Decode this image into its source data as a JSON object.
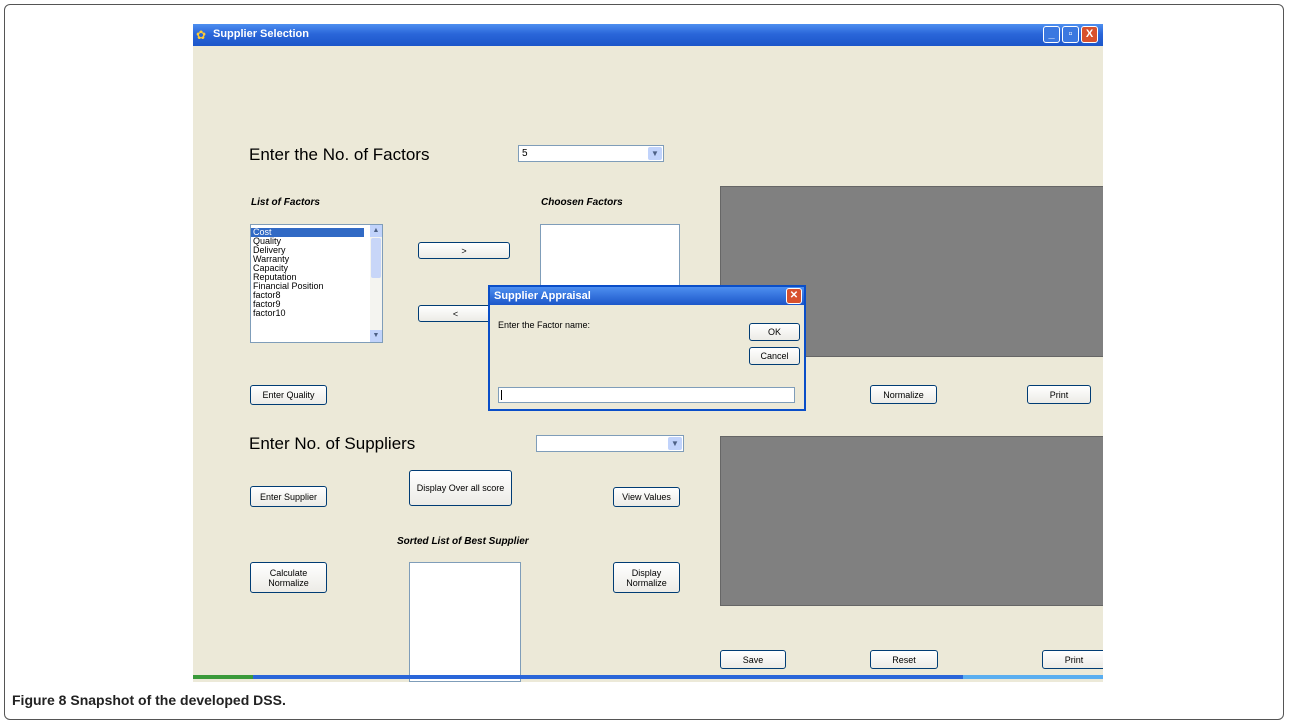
{
  "window": {
    "title": "Supplier Selection",
    "controls": [
      "_",
      "▫",
      "X"
    ]
  },
  "factors": {
    "label": "Enter the No. of Factors",
    "count_value": "5",
    "list_label": "List of Factors",
    "list_items": [
      "Cost",
      "Quality",
      "Delivery",
      "Warranty",
      "Capacity",
      "Reputation",
      "Financial Position",
      "factor8",
      "factor9",
      "factor10"
    ],
    "selected_item": "Cost",
    "chosen_label": "Choosen Factors",
    "add_button": ">",
    "remove_button": "<"
  },
  "buttons": {
    "enter_quality": "Enter Quality",
    "normalize": "Normalize",
    "print_top": "Print",
    "enter_supplier": "Enter Supplier",
    "display_overall": "Display Over all score",
    "view_values": "View Values",
    "calculate_normalize": "Calculate Normalize",
    "display_normalize": "Display Normalize",
    "save": "Save",
    "reset": "Reset",
    "print_bottom": "Print"
  },
  "suppliers": {
    "label": "Enter No. of Suppliers",
    "count_value": "",
    "sorted_label": "Sorted List of Best Supplier"
  },
  "dialog": {
    "title": "Supplier Appraisal",
    "prompt": "Enter the Factor name:",
    "ok": "OK",
    "cancel": "Cancel",
    "input_value": ""
  },
  "caption": {
    "prefix": "Figure 8",
    "text": "Snapshot of the developed DSS."
  }
}
